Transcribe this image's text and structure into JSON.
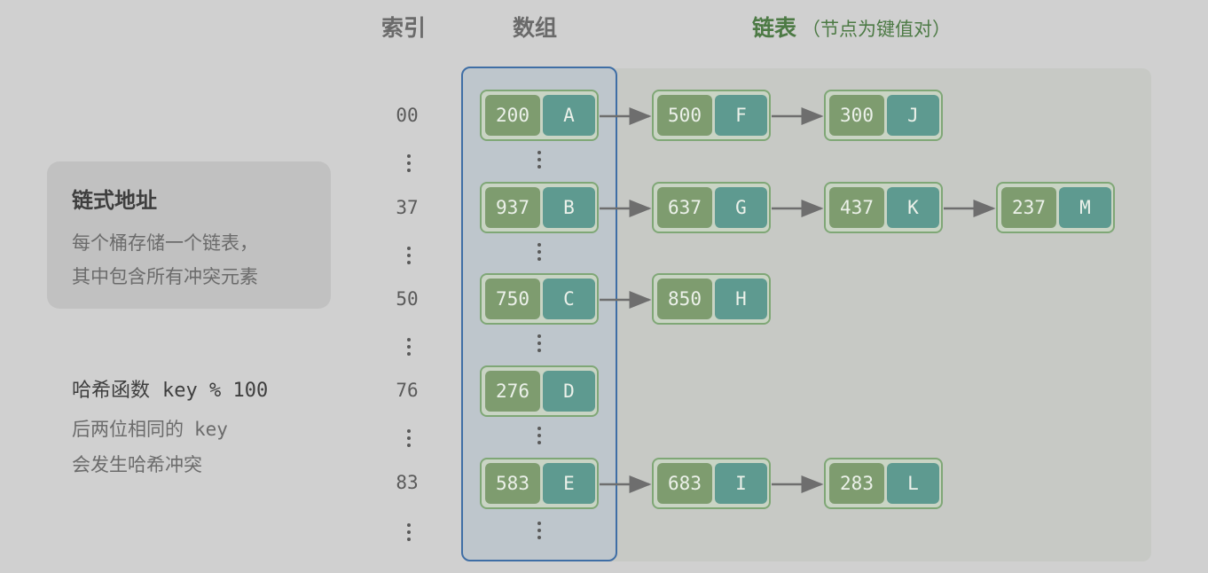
{
  "headers": {
    "index": "索引",
    "array": "数组",
    "list": "链表",
    "list_sub": "（节点为键值对）"
  },
  "card": {
    "title": "链式地址",
    "line1": "每个桶存储一个链表，",
    "line2": "其中包含所有冲突元素"
  },
  "hash": {
    "title": "哈希函数",
    "formula": "key % 100",
    "line1_prefix": "后两位相同的",
    "line1_code": "key",
    "line2": "会发生哈希冲突"
  },
  "rows": [
    {
      "index": "00",
      "bucket": {
        "key": "200",
        "value": "A"
      },
      "chain": [
        {
          "key": "500",
          "value": "F"
        },
        {
          "key": "300",
          "value": "J"
        }
      ]
    },
    {
      "index": "37",
      "bucket": {
        "key": "937",
        "value": "B"
      },
      "chain": [
        {
          "key": "637",
          "value": "G"
        },
        {
          "key": "437",
          "value": "K"
        },
        {
          "key": "237",
          "value": "M"
        }
      ]
    },
    {
      "index": "50",
      "bucket": {
        "key": "750",
        "value": "C"
      },
      "chain": [
        {
          "key": "850",
          "value": "H"
        }
      ]
    },
    {
      "index": "76",
      "bucket": {
        "key": "276",
        "value": "D"
      },
      "chain": []
    },
    {
      "index": "83",
      "bucket": {
        "key": "583",
        "value": "E"
      },
      "chain": [
        {
          "key": "683",
          "value": "I"
        },
        {
          "key": "283",
          "value": "L"
        }
      ]
    }
  ],
  "colors": {
    "background": "#d0d0d0",
    "array_border": "#3f6ea5",
    "node_key": "#7e9c6f",
    "node_value": "#5e9a90",
    "node_border": "#7fa776",
    "header_accent": "#4d7a45",
    "arrow": "#6e6e6e"
  }
}
